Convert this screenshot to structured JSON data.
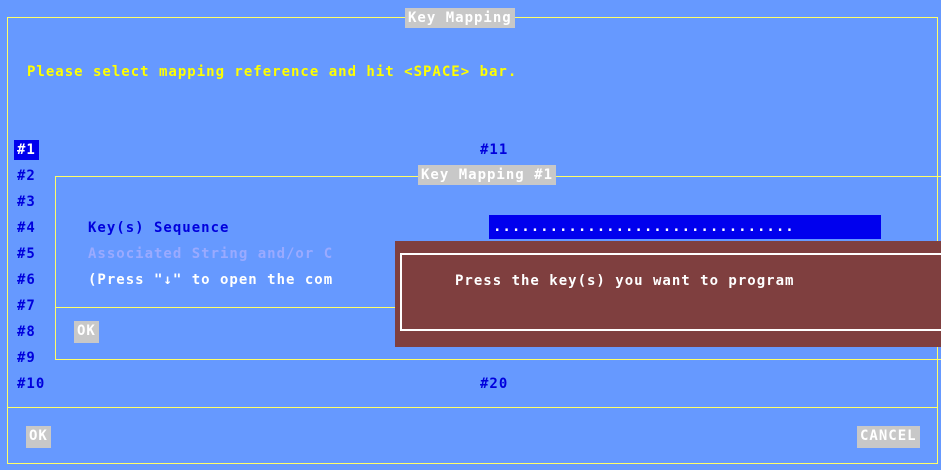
{
  "window": {
    "title": "Key Mapping"
  },
  "instruction": "Please select mapping reference and hit <SPACE> bar.",
  "refs_left": [
    "#1",
    "#2",
    "#3",
    "#4",
    "#5",
    "#6",
    "#7",
    "#8",
    "#9",
    "#10"
  ],
  "refs_right": {
    "first": "#11",
    "last": "#20"
  },
  "selected_ref": "#1",
  "dialog": {
    "title": "Key Mapping #1",
    "key_sequence_label": "Key(s) Sequence",
    "key_sequence_value": "................................",
    "associated_label": "Associated String and/or C",
    "hint_label": "(Press \"↓\" to open the com",
    "ok_label": "OK"
  },
  "popup": {
    "message": "Press the key(s) you want to program"
  },
  "footer": {
    "ok_label": "OK",
    "cancel_label": "CANCEL"
  },
  "colors": {
    "background": "#6699ff",
    "border": "#ffff66",
    "selection": "#0000ee",
    "popup": "#7f3f3f"
  }
}
